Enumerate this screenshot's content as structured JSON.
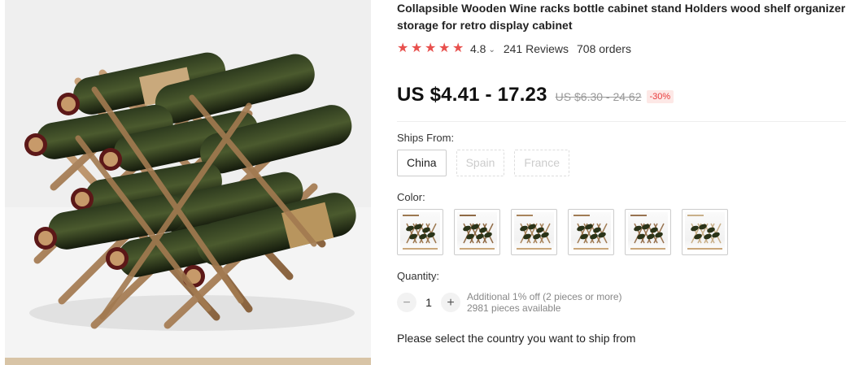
{
  "product": {
    "title": "Collapsible Wooden Wine racks bottle cabinet stand Holders wood shelf organizer storage for retro display cabinet",
    "rating": "4.8",
    "reviews": "241 Reviews",
    "orders": "708 orders",
    "star_count": 5,
    "star_color": "#e8504d"
  },
  "price": {
    "current": "US $4.41 - 17.23",
    "original": "US $6.30 - 24.62",
    "discount": "-30%"
  },
  "ships_from": {
    "label": "Ships From:",
    "options": [
      {
        "label": "China",
        "available": true
      },
      {
        "label": "Spain",
        "available": false
      },
      {
        "label": "France",
        "available": false
      }
    ]
  },
  "color": {
    "label": "Color:",
    "option_count": 6
  },
  "quantity": {
    "label": "Quantity:",
    "value": "1",
    "decrement_icon": "−",
    "increment_icon": "+",
    "additional_offer": "Additional 1% off (2 pieces or more)",
    "available": "2981 pieces available"
  },
  "ship_note": "Please select the country you want to ship from",
  "icons": {
    "star": "star-icon",
    "chevron": "chevron-down-icon"
  }
}
